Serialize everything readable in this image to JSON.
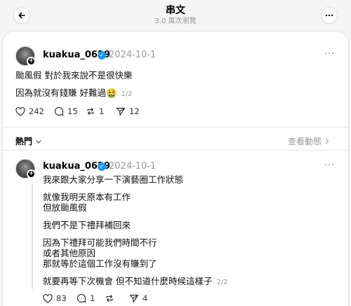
{
  "header": {
    "title": "串文",
    "subtitle": "3.0 萬次瀏覽"
  },
  "post1": {
    "username": "kuakua_0629",
    "date": "2024-10-1",
    "lines": [
      "颱風假 對於我來說不是很快樂",
      "因為就沒有錢賺 好難過🤮"
    ],
    "pager": "1/2",
    "likes": "242",
    "replies": "15",
    "reposts": "1",
    "shares": "12"
  },
  "sort": {
    "label": "熱門",
    "activity_label": "查看動態"
  },
  "post2": {
    "username": "kuakua_0629",
    "date": "2024-10-1",
    "line1": "我來跟大家分享一下演藝圈工作狀態",
    "p1": [
      "就像我明天原本有工作",
      "但放颱風假"
    ],
    "p2": "我們不是下禮拜補回來",
    "p3": [
      "因為下禮拜可能我們時間不行",
      "或者其他原因",
      "那就等於這個工作沒有賺到了"
    ],
    "p4": "就要再等下次機會 但不知道什麼時候這樣子",
    "pager": "2/2",
    "likes": "83",
    "replies": "1",
    "reposts": "",
    "shares": "4"
  }
}
